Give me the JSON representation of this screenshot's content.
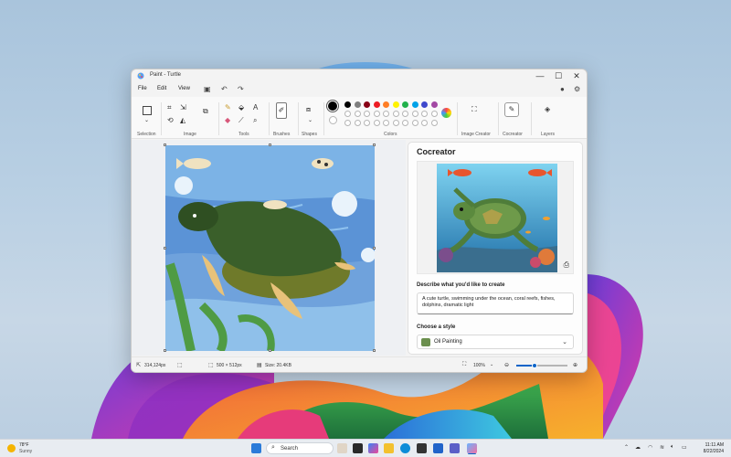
{
  "window": {
    "title": "Paint - Turtle",
    "controls": {
      "minimize": "—",
      "maximize": "☐",
      "close": "✕"
    }
  },
  "menu": {
    "file": "File",
    "edit": "Edit",
    "view": "View"
  },
  "ribbon": {
    "groups": {
      "selection": "Selection",
      "image": "Image",
      "tools": "Tools",
      "brushes": "Brushes",
      "shapes": "Shapes",
      "colors": "Colors",
      "image_creator": "Image Creator",
      "cocreator": "Cocreator",
      "layers": "Layers"
    },
    "palette_row1": [
      "#000000",
      "#7f7f7f",
      "#880015",
      "#ed1c24",
      "#ff7f27",
      "#fff200",
      "#22b14c",
      "#00a2e8",
      "#3f48cc",
      "#a349a4"
    ],
    "palette_row2": [
      "#ffffff",
      "#c3c3c3",
      "#b97a57",
      "#ffaec9",
      "#ffc90e",
      "#efe4b0",
      "#b5e61d",
      "#99d9ea",
      "#7092be",
      "#c8bfe7"
    ]
  },
  "statusbar": {
    "cursor": "314,124px",
    "canvas_size": "500 × 512px",
    "file_size": "Size: 20.4KB",
    "zoom": "100%"
  },
  "cocreator": {
    "title": "Cocreator",
    "describe_label": "Describe what you'd like to create",
    "prompt": "A cute turtle, swimming under the ocean, coral reefs, fishes, dolphins, dramatic light",
    "style_label": "Choose a style",
    "style_value": "Oil Painting"
  },
  "taskbar": {
    "weather_temp": "78°F",
    "weather_desc": "Sunny",
    "search_placeholder": "Search",
    "time": "11:11 AM",
    "date": "8/22/2024"
  }
}
